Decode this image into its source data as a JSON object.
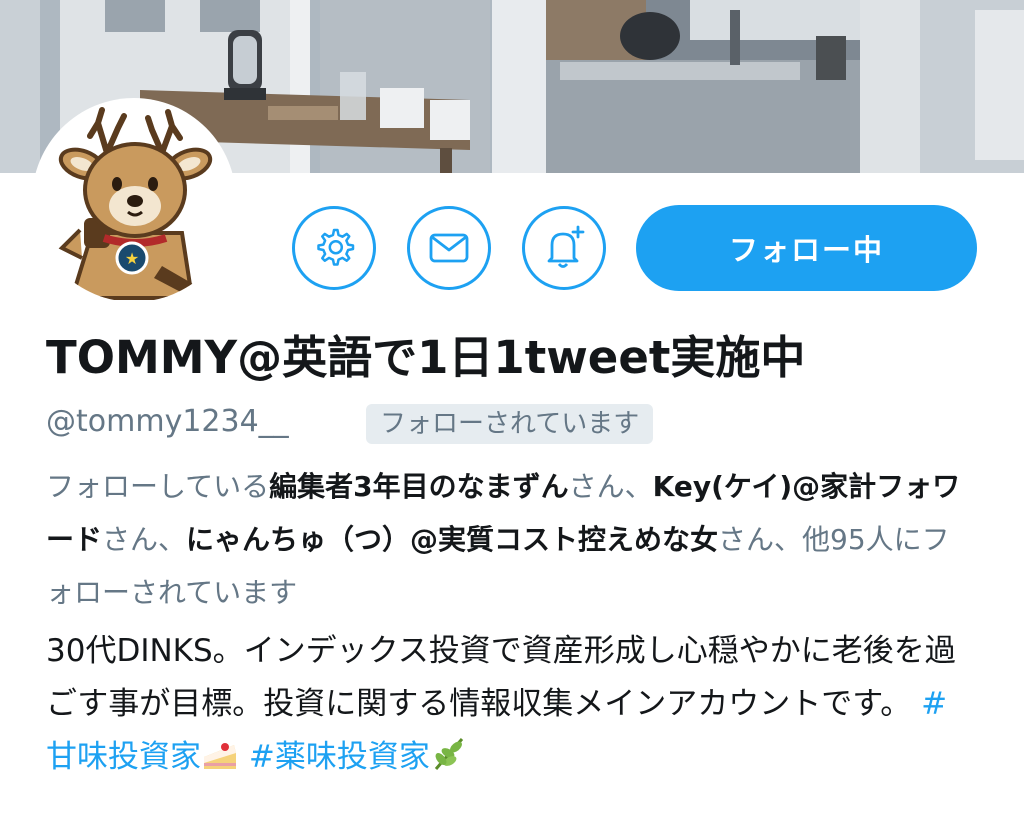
{
  "profile": {
    "display_name": "TOMMY@英語で1日1tweet実施中",
    "handle": "@tommy1234__",
    "follows_you_badge": "フォローされています",
    "follow_button_label": "フォロー中",
    "icons": {
      "settings": "gear-icon",
      "message": "envelope-icon",
      "notifications": "bell-plus-icon",
      "avatar": "deer-mascot"
    },
    "accent_color": "#1da1f2"
  },
  "followed_by": {
    "prefix": "フォローしている",
    "name1": "編集者3年目のなまずん",
    "sep1": "さん、",
    "name2": "Key(ケイ)@家計フォワード",
    "sep2": "さん、",
    "name3": "にゃんちゅ（つ）@実質コスト控えめな女",
    "suffix": "さん、他95人にフォローされています"
  },
  "bio": {
    "text": "30代DINKS。インデックス投資で資産形成し心穏やかに老後を過ごす事が目標。投資に関する情報収集メインアカウントです。",
    "hashtag1": "#甘味投資家",
    "hashtag1_emoji": "cake-icon",
    "hashtag2": "#薬味投資家",
    "hashtag2_emoji": "herb-icon"
  }
}
